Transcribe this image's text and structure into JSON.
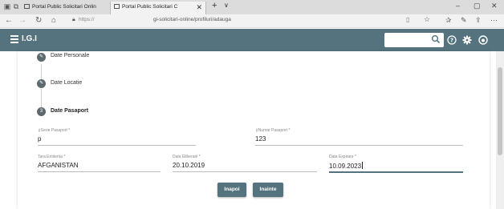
{
  "browser": {
    "tabs": [
      {
        "title": "Portal Public Solicitari Onlin"
      },
      {
        "title": "Portal Public Solicitari C",
        "active": true
      }
    ],
    "new_tab_glyph": "+",
    "tab_list_glyph": "∨",
    "close_tab_glyph": "✕",
    "address": {
      "scheme": "https://",
      "path": "gi-solicitari-online/profiluri/adauga"
    },
    "window_controls": {
      "minimize": "–",
      "restore": "▢",
      "close": "✕"
    }
  },
  "app": {
    "title": "I.G.I",
    "search": {
      "placeholder": "",
      "value": ""
    },
    "header_icons": [
      "search-icon",
      "help-icon",
      "settings-icon",
      "account-icon"
    ],
    "accent_color": "#55737e"
  },
  "stepper": {
    "steps": [
      {
        "label": "Date Personale",
        "state": "edit",
        "glyph": "✎"
      },
      {
        "label": "Date Locatie",
        "state": "edit",
        "glyph": "✎"
      },
      {
        "label": "Date Pasaport",
        "state": "active",
        "glyph": "3"
      }
    ]
  },
  "form": {
    "serie_pasaport": {
      "label": "Serie Pasaport *",
      "value": "p"
    },
    "numar_pasaport": {
      "label": "Numar Pasaport *",
      "value": "123"
    },
    "tara_emitenta": {
      "label": "Tara Emitenta *",
      "value": "AFGANISTAN"
    },
    "data_eliberarii": {
      "label": "Data Eliberarii *",
      "value": "20.10.2019"
    },
    "data_expirare": {
      "label": "Data Expirare *",
      "value": "10.09.2023"
    }
  },
  "buttons": {
    "back": "Inapoi",
    "next": "Inainte"
  }
}
